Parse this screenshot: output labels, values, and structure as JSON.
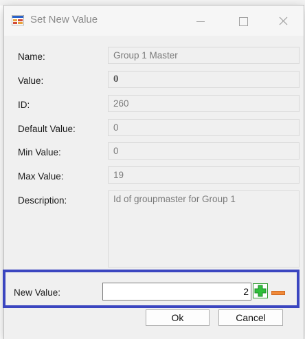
{
  "background": {
    "clipped_text": "…"
  },
  "window": {
    "title": "Set New Value",
    "controls": [
      "minimize",
      "maximize",
      "close"
    ]
  },
  "fields": [
    {
      "label": "Name:",
      "value": "Group 1 Master"
    },
    {
      "label": "Value:",
      "value": "0"
    },
    {
      "label": "ID:",
      "value": "260"
    },
    {
      "label": "Default Value:",
      "value": "0"
    },
    {
      "label": "Min Value:",
      "value": "0"
    },
    {
      "label": "Max Value:",
      "value": "19"
    },
    {
      "label": "Description:",
      "value": "Id of groupmaster for Group 1"
    }
  ],
  "new_value": {
    "label": "New Value:",
    "value": "2"
  },
  "buttons": {
    "ok": "Ok",
    "cancel": "Cancel"
  },
  "colors": {
    "highlight_border": "#3b46c0",
    "plus_green": "#2fbf3a",
    "minus_orange": "#f08a3a"
  }
}
